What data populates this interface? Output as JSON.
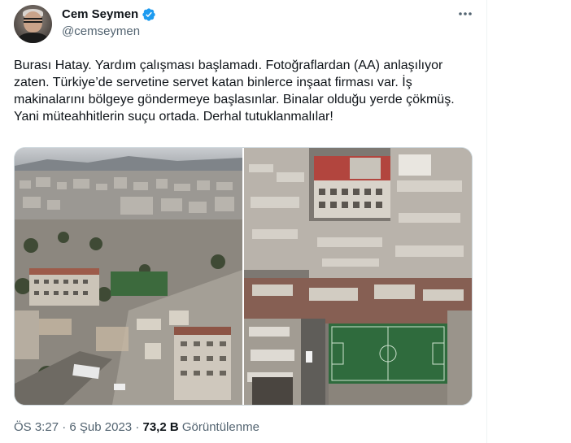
{
  "author": {
    "display_name": "Cem Seymen",
    "handle": "@cemseymen",
    "avatar_icon": "profile-photo",
    "verified_icon": "verified-badge-icon",
    "verified_color": "#1d9bf0"
  },
  "menu": {
    "icon": "more-options-icon"
  },
  "tweet": {
    "text": "Burası Hatay. Yardım çalışması başlamadı. Fotoğraflardan (AA) anlaşılıyor zaten. Türkiye’de servetine servet katan binlerce inşaat firması var. İş makinalarını bölgeye göndermeye başlasınlar. Binalar olduğu yerde çökmüş. Yani müteahhitlerin suçu ortada. Derhal tutuklanmalılar!"
  },
  "media": {
    "photos": [
      {
        "name": "aerial-city-rubble-photo"
      },
      {
        "name": "aerial-collapsed-buildings-field-photo"
      }
    ]
  },
  "meta": {
    "time": "ÖS 3:27",
    "separator": "·",
    "date": "6 Şub 2023",
    "views_count": "73,2 B",
    "views_label": "Görüntülenme"
  },
  "colors": {
    "text_primary": "#0f1419",
    "text_secondary": "#536471",
    "border": "#cfd9de",
    "verified": "#1d9bf0"
  }
}
